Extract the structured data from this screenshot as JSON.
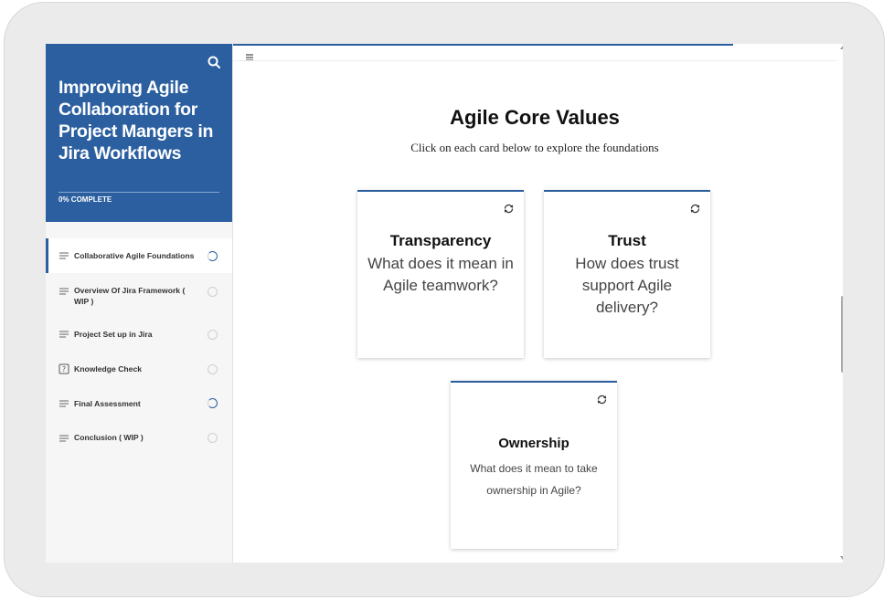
{
  "course": {
    "title": "Improving Agile Collaboration for Project Mangers in Jira Workflows",
    "progress_label": "0% COMPLETE"
  },
  "nav": {
    "items": [
      {
        "label": "Collaborative Agile Foundations",
        "icon": "lines-icon",
        "status": "in-progress"
      },
      {
        "label": "Overview Of Jira Framework ( WIP )",
        "icon": "lines-icon",
        "status": "not-started"
      },
      {
        "label": "Project Set up in Jira",
        "icon": "lines-icon",
        "status": "not-started"
      },
      {
        "label": "Knowledge Check",
        "icon": "question-icon",
        "status": "not-started"
      },
      {
        "label": "Final Assessment",
        "icon": "lines-icon",
        "status": "in-progress"
      },
      {
        "label": "Conclusion ( WIP )",
        "icon": "lines-icon",
        "status": "not-started"
      }
    ]
  },
  "lesson": {
    "title": "Agile Core Values",
    "subtitle": "Click on each card below to explore the foundations"
  },
  "cards": [
    {
      "title": "Transparency",
      "text": "What does it mean in Agile teamwork?"
    },
    {
      "title": "Trust",
      "text": "How does trust support Agile delivery?"
    },
    {
      "title": "Ownership",
      "text": "What does it mean to take ownership in Agile?"
    }
  ],
  "colors": {
    "accent": "#2b5fa0",
    "sidebar_bg": "#f6f6f6",
    "frame": "#ebebeb"
  }
}
